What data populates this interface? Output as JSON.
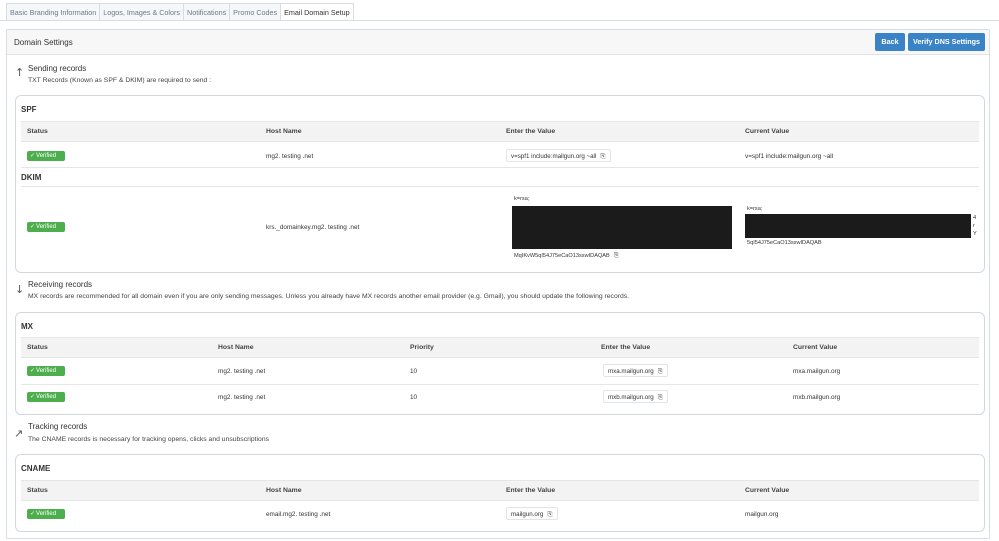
{
  "tabs": [
    "Basic Branding Information",
    "Logos, Images & Colors",
    "Notifications",
    "Promo Codes",
    "Email Domain Setup"
  ],
  "header": {
    "title": "Domain Settings",
    "back": "Back",
    "verify": "Verify DNS Settings"
  },
  "sending": {
    "title": "Sending records",
    "desc": "TXT Records (Known as SPF & DKIM) are required to send :"
  },
  "receiving": {
    "title": "Receiving records",
    "desc": "MX records are recommended for all domain even if you are only sending messages. Unless you already have MX records another email provider (e.g. Gmail), you should update the following records."
  },
  "tracking": {
    "title": "Tracking records",
    "desc": "The CNAME records is necessary for tracking opens, clicks and unsubscriptions"
  },
  "cols4": {
    "status": "Status",
    "host": "Host Name",
    "enter": "Enter the Value",
    "current": "Current Value"
  },
  "cols5": {
    "status": "Status",
    "host": "Host Name",
    "priority": "Priority",
    "enter": "Enter the Value",
    "current": "Current Value"
  },
  "badge": "Verified",
  "icons": {
    "copy": "copy-icon",
    "check": "check-icon",
    "up": "arrow-up-icon",
    "down": "arrow-down-icon",
    "track": "tracking-icon"
  },
  "spf": {
    "label": "SPF",
    "host": "mg2. testing .net",
    "value": "v=spf1 include:mailgun.org ~all",
    "current": "v=spf1 include:mailgun.org ~all"
  },
  "dkim": {
    "label": "DKIM",
    "host": "krs._domainkey.mg2. testing .net",
    "value_start": "k=rsa;",
    "value_end": "MqIKvW5qI54J75eCaO13sswIDAQAB",
    "current_start": "k=rsa;",
    "current_end": "5qI54J75eCaO13sswIDAQAB",
    "current_edge": [
      "4",
      "r",
      "Y"
    ]
  },
  "mx": {
    "label": "MX",
    "rows": [
      {
        "host": "mg2. testing .net",
        "priority": "10",
        "value": "mxa.mailgun.org",
        "current": "mxa.mailgun.org"
      },
      {
        "host": "mg2. testing .net",
        "priority": "10",
        "value": "mxb.mailgun.org",
        "current": "mxb.mailgun.org"
      }
    ]
  },
  "cname": {
    "label": "CNAME",
    "host": "email.mg2. testing .net",
    "value": "mailgun.org",
    "current": "mailgun.org"
  }
}
